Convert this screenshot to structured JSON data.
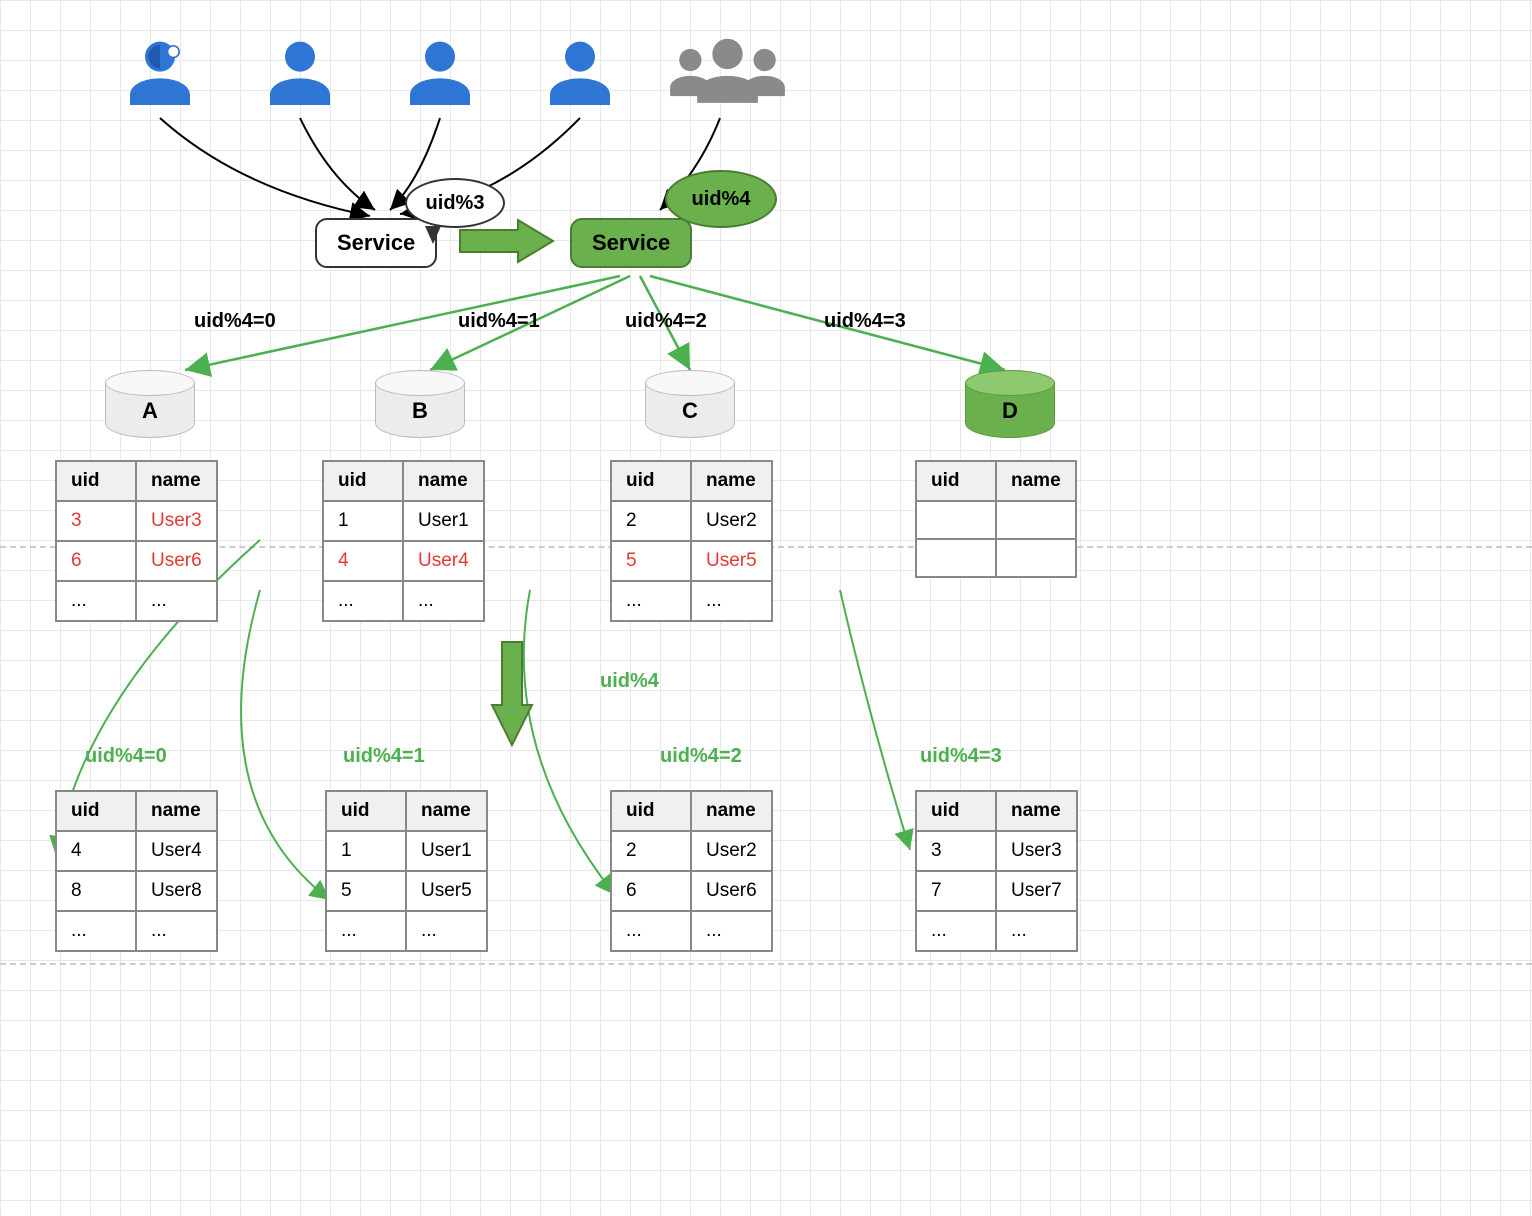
{
  "service_left": {
    "label": "Service",
    "bubble": "uid%3"
  },
  "service_right": {
    "label": "Service",
    "bubble": "uid%4"
  },
  "branch_labels": {
    "l0": "uid%4=0",
    "l1": "uid%4=1",
    "l2": "uid%4=2",
    "l3": "uid%4=3"
  },
  "bottom_labels": {
    "main": "uid%4",
    "l0": "uid%4=0",
    "l1": "uid%4=1",
    "l2": "uid%4=2",
    "l3": "uid%4=3"
  },
  "top_tables": {
    "A": {
      "name": "A",
      "headers": {
        "uid": "uid",
        "name": "name"
      },
      "rows": [
        {
          "uid": "3",
          "name": "User3",
          "red": true
        },
        {
          "uid": "6",
          "name": "User6",
          "red": true
        },
        {
          "uid": "...",
          "name": "..."
        }
      ]
    },
    "B": {
      "name": "B",
      "headers": {
        "uid": "uid",
        "name": "name"
      },
      "rows": [
        {
          "uid": "1",
          "name": "User1"
        },
        {
          "uid": "4",
          "name": "User4",
          "red": true
        },
        {
          "uid": "...",
          "name": "..."
        }
      ]
    },
    "C": {
      "name": "C",
      "headers": {
        "uid": "uid",
        "name": "name"
      },
      "rows": [
        {
          "uid": "2",
          "name": "User2"
        },
        {
          "uid": "5",
          "name": "User5",
          "red": true
        },
        {
          "uid": "...",
          "name": "..."
        }
      ]
    },
    "D": {
      "name": "D",
      "headers": {
        "uid": "uid",
        "name": "name"
      },
      "rows": [
        {
          "uid": "",
          "name": ""
        },
        {
          "uid": "",
          "name": ""
        }
      ]
    }
  },
  "bottom_tables": {
    "T0": {
      "headers": {
        "uid": "uid",
        "name": "name"
      },
      "rows": [
        {
          "uid": "4",
          "name": "User4"
        },
        {
          "uid": "8",
          "name": "User8"
        },
        {
          "uid": "...",
          "name": "..."
        }
      ]
    },
    "T1": {
      "headers": {
        "uid": "uid",
        "name": "name"
      },
      "rows": [
        {
          "uid": "1",
          "name": "User1"
        },
        {
          "uid": "5",
          "name": "User5"
        },
        {
          "uid": "...",
          "name": "..."
        }
      ]
    },
    "T2": {
      "headers": {
        "uid": "uid",
        "name": "name"
      },
      "rows": [
        {
          "uid": "2",
          "name": "User2"
        },
        {
          "uid": "6",
          "name": "User6"
        },
        {
          "uid": "...",
          "name": "..."
        }
      ]
    },
    "T3": {
      "headers": {
        "uid": "uid",
        "name": "name"
      },
      "rows": [
        {
          "uid": "3",
          "name": "User3"
        },
        {
          "uid": "7",
          "name": "User7"
        },
        {
          "uid": "...",
          "name": "..."
        }
      ]
    }
  }
}
